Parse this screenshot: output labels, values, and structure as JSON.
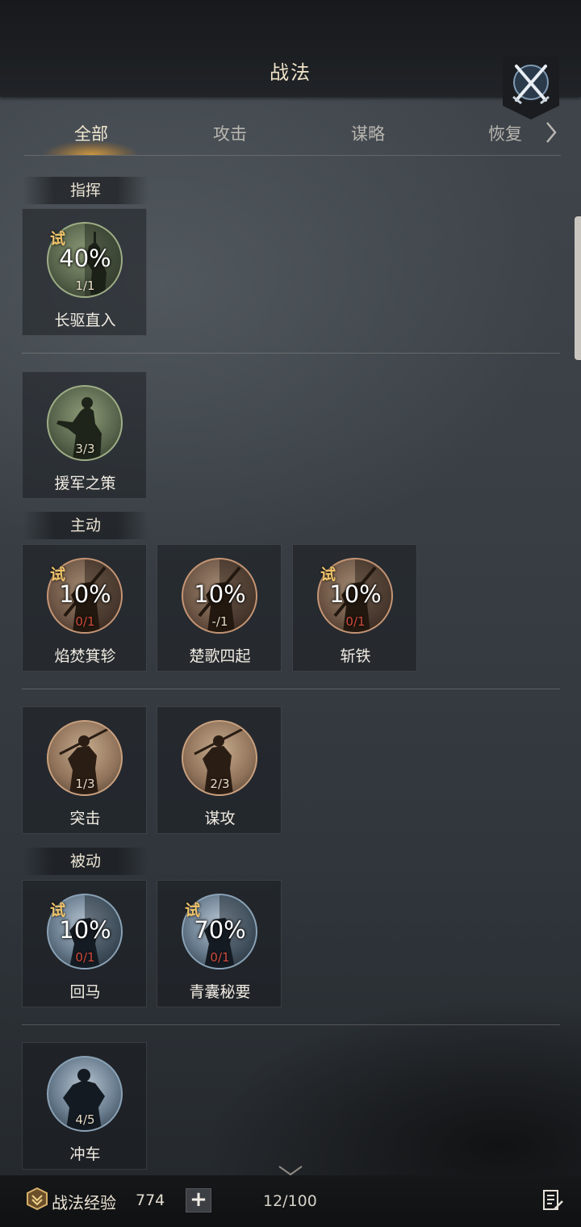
{
  "header": {
    "title": "战法"
  },
  "tabs": [
    {
      "label": "全部",
      "active": true
    },
    {
      "label": "攻击",
      "active": false
    },
    {
      "label": "谋略",
      "active": false
    },
    {
      "label": "恢复",
      "active": false
    }
  ],
  "sections": {
    "command": {
      "label": "指挥"
    },
    "active": {
      "label": "主动"
    },
    "passive": {
      "label": "被动"
    }
  },
  "tactics": {
    "t1": {
      "name": "长驱直入",
      "trial": "试",
      "percent": "40%",
      "count": "1/1",
      "style": "green"
    },
    "t2": {
      "name": "援军之策",
      "count": "3/3",
      "style": "green"
    },
    "t3": {
      "name": "焰焚箕轸",
      "trial": "试",
      "percent": "10%",
      "count": "0/1",
      "style": "brown"
    },
    "t4": {
      "name": "楚歌四起",
      "percent": "10%",
      "count": "-/1",
      "style": "brown"
    },
    "t5": {
      "name": "斩铁",
      "trial": "试",
      "percent": "10%",
      "count": "0/1",
      "style": "brown"
    },
    "t6": {
      "name": "突击",
      "count": "1/3",
      "style": "tan"
    },
    "t7": {
      "name": "谋攻",
      "count": "2/3",
      "style": "tan"
    },
    "t8": {
      "name": "回马",
      "trial": "试",
      "percent": "10%",
      "count": "0/1",
      "style": "blue"
    },
    "t9": {
      "name": "青囊秘要",
      "trial": "试",
      "percent": "70%",
      "count": "0/1",
      "style": "blue"
    },
    "t10": {
      "name": "冲车",
      "count": "4/5",
      "style": "blue"
    }
  },
  "footer": {
    "exp_label": "战法经验",
    "exp_value": "774",
    "add_label": "+",
    "capacity": "12/100"
  },
  "icons": {
    "close": "crossed-swords-icon",
    "tab_next": "chevron-right-icon",
    "scroll_down": "chevron-down-icon",
    "exp": "exp-badge-icon",
    "list": "list-edit-icon"
  },
  "colors": {
    "accent_gold": "#f0c46a",
    "tab_glow": "#e6a53c",
    "count_red": "#d04a3c"
  }
}
